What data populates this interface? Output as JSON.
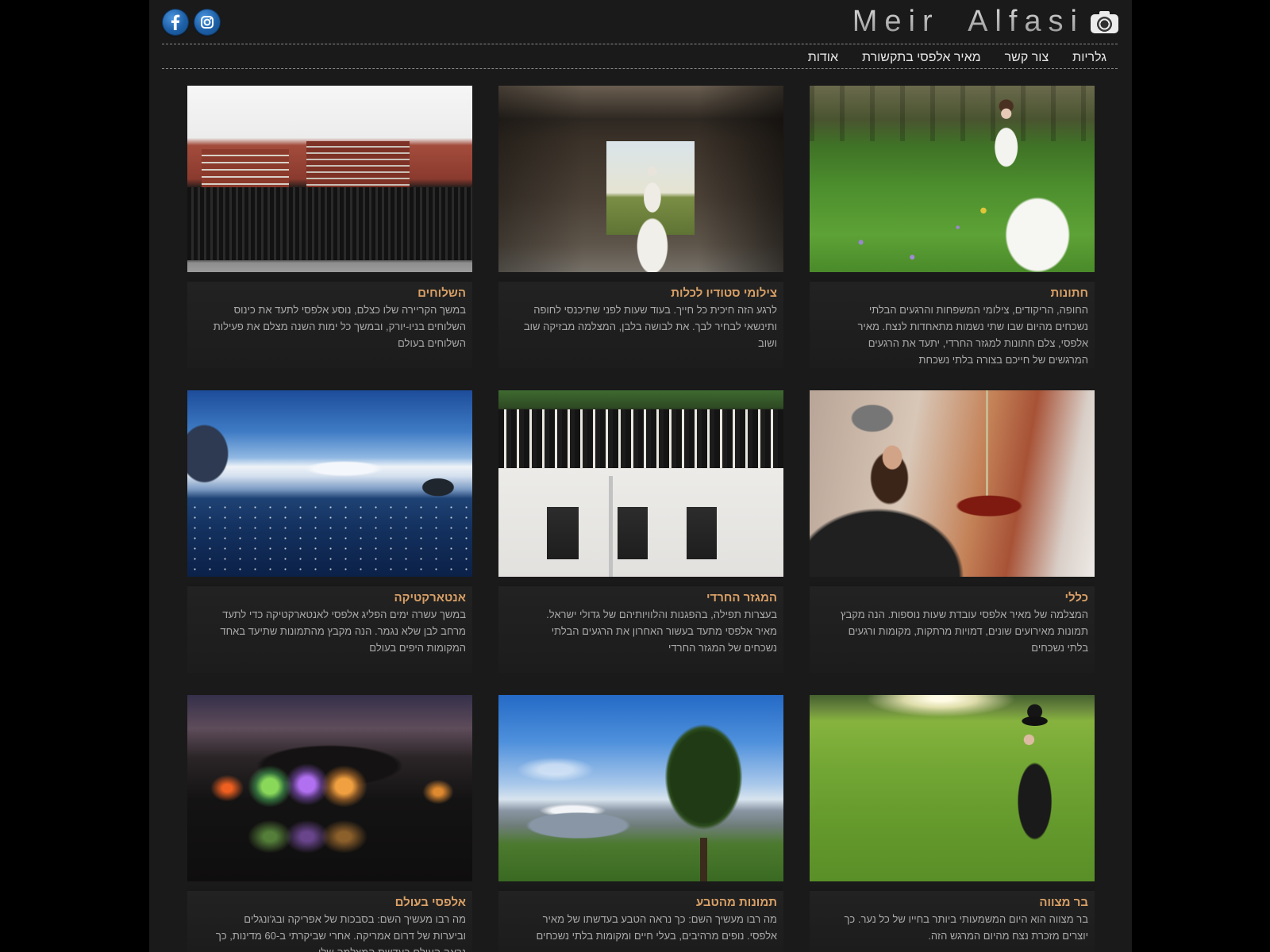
{
  "colors": {
    "page_background": "#000000",
    "panel_background": "#1a1a1a",
    "caption_title": "#d9a066",
    "caption_text": "#a9a9a9",
    "nav_text": "#e6e6e6",
    "divider": "#8a8a8a",
    "social_icon": "#1d5fa6"
  },
  "header": {
    "social": [
      {
        "icon": "facebook-icon"
      },
      {
        "icon": "instagram-icon"
      }
    ],
    "logo": {
      "text": "Meir Alfasi",
      "icon": "camera-icon"
    }
  },
  "nav": {
    "items": [
      {
        "label": "גלריות"
      },
      {
        "label": "צור קשר"
      },
      {
        "label": "מאיר אלפסי בתקשורת"
      },
      {
        "label": "אודות"
      }
    ]
  },
  "galleries": [
    {
      "title": "חתונות",
      "description": "החופה, הריקודים, צילומי המשפחות והרגעים הבלתי נשכחים מהיום שבו שתי נשמות מתאחדות לנצח. מאיר אלפסי, צלם חתונות למגזר החרדי, יתעד את הרגעים המרגשים של חייכם בצורה בלתי נשכחת"
    },
    {
      "title": "צילומי סטודיו לכלות",
      "description": "לרגע הזה חיכית כל חייך. בעוד שעות לפני שתיכנסי לחופה ותינשאי לבחיר לבך. את לבושה בלבן, המצלמה מבזיקה שוב ושוב"
    },
    {
      "title": "השלוחים",
      "description": "במשך הקריירה שלו כצלם, נוסע אלפסי לתעד את כינוס השלוחים בניו-יורק, ובמשך כל ימות השנה מצלם את פעילות השלוחים בעולם"
    },
    {
      "title": "כללי",
      "description": "המצלמה של מאיר אלפסי עובדת שעות נוספות. הנה מקבץ תמונות מאירועים שונים, דמויות מרתקות, מקומות ורגעים בלתי נשכחים"
    },
    {
      "title": "המגזר החרדי",
      "description": "בעצרות תפילה, בהפגנות והלוויותיהם של גדולי ישראל. מאיר אלפסי מתעד בעשור האחרון את הרגעים הבלתי נשכחים של המגזר החרדי"
    },
    {
      "title": "אנטארקטיקה",
      "description": "במשך עשרה ימים הפליג אלפסי לאנטארקטיקה כדי לתעד מרחב לבן שלא נגמר. הנה מקבץ מהתמונות שתיעד באחד המקומות היפים בעולם"
    },
    {
      "title": "בר מצווה",
      "description": "בר מצווה הוא היום המשמעותי ביותר בחייו של כל נער. כך יוצרים מזכרת נצח מהיום המרגש הזה."
    },
    {
      "title": "תמונות מהטבע",
      "description": "מה רבו מעשיך השם: כך נראה הטבע בעדשתו של מאיר אלפסי. נופים מרהיבים, בעלי חיים ומקומות בלתי נשכחים"
    },
    {
      "title": "אלפסי בעולם",
      "description": "מה רבו מעשיך השם: בסבכות של אפריקה ובג'ונגלים וביערות של דרום אמריקה. אחרי שביקרתי ב-60 מדינות, כך נראה העולם בעדשת המצלמה שלי"
    }
  ]
}
